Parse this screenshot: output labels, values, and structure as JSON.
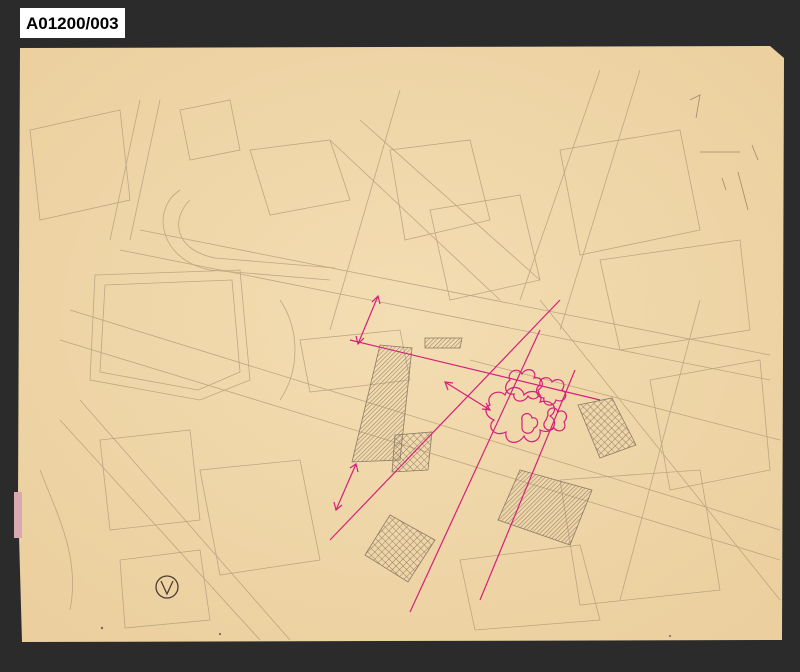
{
  "document": {
    "archive_id": "A01200/003"
  },
  "colors": {
    "background": "#2b2b2b",
    "paper": "#f1d8ab",
    "pencil": "#b59e7c",
    "hatch": "#8c7a66",
    "magenta": "#d6207a"
  },
  "icons": {
    "north_marker": "circled-v-icon"
  }
}
